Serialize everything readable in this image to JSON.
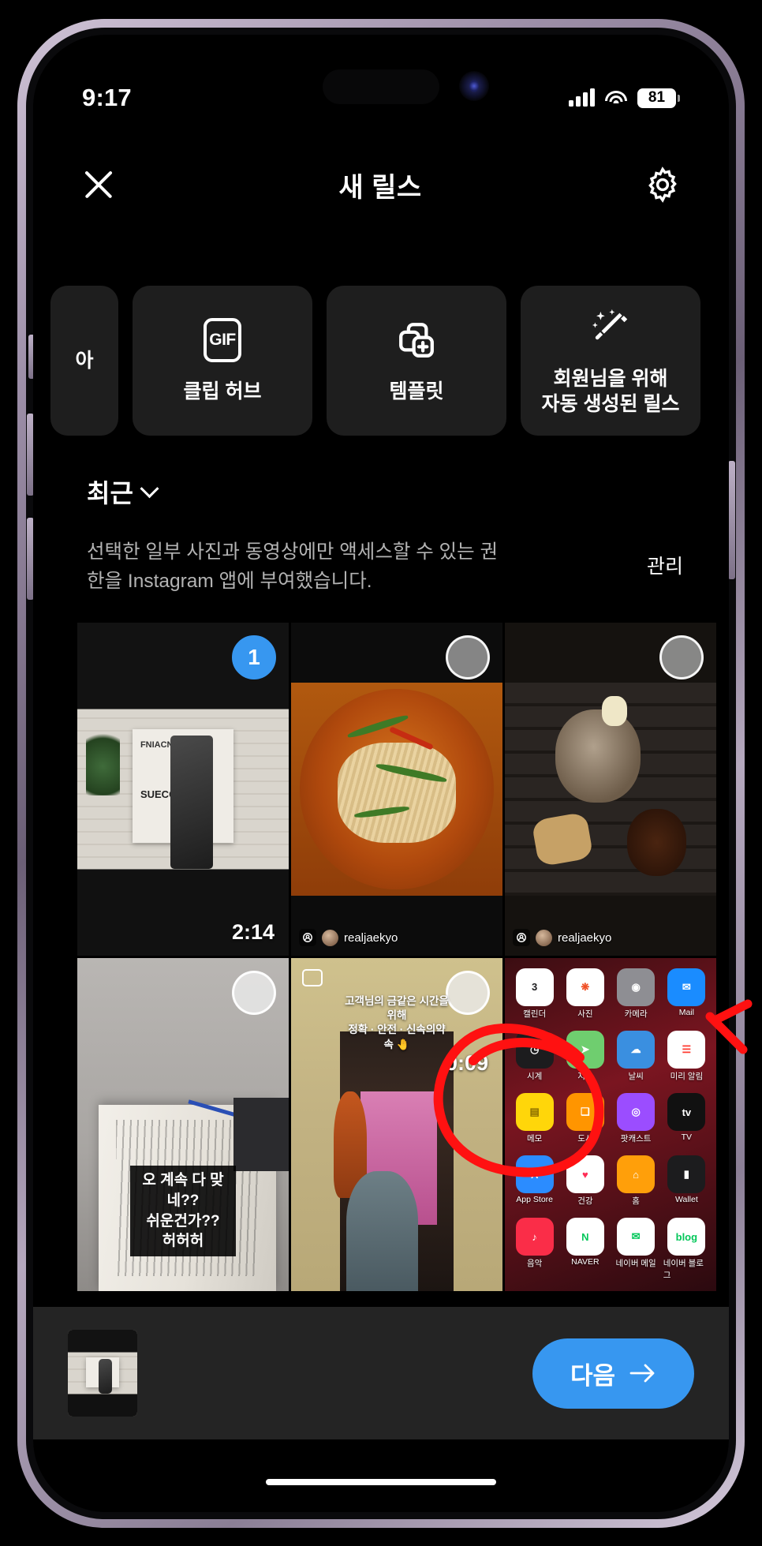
{
  "status_bar": {
    "time": "9:17",
    "battery_percent": "81",
    "signal_icon": "cellular-bars-icon",
    "wifi_icon": "wifi-icon",
    "battery_icon": "battery-icon",
    "front_camera_icon": "front-camera-icon"
  },
  "header": {
    "close_icon": "close-x-icon",
    "title": "새 릴스",
    "settings_icon": "gear-icon"
  },
  "option_cards": [
    {
      "label": "아",
      "icon": "partial-card-icon",
      "partial": true
    },
    {
      "label": "클립 허브",
      "icon": "gif-icon"
    },
    {
      "label": "템플릿",
      "icon": "template-stack-plus-icon"
    },
    {
      "label": "회원님을 위해\n자동 생성된 릴스",
      "icon": "magic-wand-sparkle-icon"
    }
  ],
  "gallery": {
    "sort_label": "최근",
    "sort_chevron_icon": "chevron-down-icon",
    "permission_text": "선택한 일부 사진과 동영상에만 액세스할 수 있는 권한을 Instagram 앱에 부여했습니다.",
    "manage_label": "관리"
  },
  "media_items": [
    {
      "art": "poster",
      "selected": true,
      "selection_number": "1",
      "duration": "2:14",
      "tag": null,
      "poster_title": "FNIACN      TES",
      "poster_sub": "SUECC",
      "video_badge": false,
      "caption": null,
      "top_caption": null
    },
    {
      "art": "noodle",
      "selected": false,
      "selection_number": "",
      "duration": "",
      "tag": "realjaekyo",
      "video_badge": false,
      "caption": null,
      "top_caption": null
    },
    {
      "art": "grill",
      "selected": false,
      "selection_number": "",
      "duration": "",
      "tag": "realjaekyo",
      "video_badge": false,
      "caption": null,
      "top_caption": null
    },
    {
      "art": "book",
      "selected": false,
      "selection_number": "",
      "duration": "",
      "tag": null,
      "video_badge": false,
      "caption": "오 계속 다 맞네??\n쉬운건가??\n허허허",
      "top_caption": null
    },
    {
      "art": "room",
      "selected": false,
      "selection_number": "",
      "duration": "0:09",
      "tag": null,
      "video_badge": true,
      "caption": null,
      "top_caption": "고객님의 금같은 시간을 위해\n정확 · 안전 · 신속의약속 🤚"
    },
    {
      "art": "home",
      "selected": false,
      "selection_number": "",
      "duration": "",
      "tag": null,
      "video_badge": false,
      "caption": null,
      "top_caption": null
    }
  ],
  "home_screen_apps": [
    {
      "name": "캘린더",
      "glyph": "3",
      "color": "#ffffff",
      "text_color": "#1c1c1e"
    },
    {
      "name": "사진",
      "glyph": "❋",
      "color": "#ffffff",
      "text_color": "#f04e23"
    },
    {
      "name": "카메라",
      "glyph": "◉",
      "color": "#8e8e93",
      "text_color": "#ffffff"
    },
    {
      "name": "Mail",
      "glyph": "✉",
      "color": "#1a8cff",
      "text_color": "#ffffff"
    },
    {
      "name": "시계",
      "glyph": "◷",
      "color": "#1c1c1e",
      "text_color": "#ffffff"
    },
    {
      "name": "지도",
      "glyph": "➤",
      "color": "#6fce6f",
      "text_color": "#ffffff"
    },
    {
      "name": "날씨",
      "glyph": "☁",
      "color": "#3a8fe0",
      "text_color": "#ffffff"
    },
    {
      "name": "미리 알림",
      "glyph": "☰",
      "color": "#ffffff",
      "text_color": "#ff3b30"
    },
    {
      "name": "메모",
      "glyph": "▤",
      "color": "#ffd60a",
      "text_color": "#8a6d00"
    },
    {
      "name": "도서",
      "glyph": "❏",
      "color": "#ff9500",
      "text_color": "#ffffff"
    },
    {
      "name": "팟캐스트",
      "glyph": "◎",
      "color": "#9b4dff",
      "text_color": "#ffffff"
    },
    {
      "name": "TV",
      "glyph": "tv",
      "color": "#111111",
      "text_color": "#ffffff"
    },
    {
      "name": "App Store",
      "glyph": "A",
      "color": "#2b8cff",
      "text_color": "#ffffff"
    },
    {
      "name": "건강",
      "glyph": "♥",
      "color": "#ffffff",
      "text_color": "#ff2d55"
    },
    {
      "name": "홈",
      "glyph": "⌂",
      "color": "#ff9f0a",
      "text_color": "#ffffff"
    },
    {
      "name": "Wallet",
      "glyph": "▮",
      "color": "#1c1c1e",
      "text_color": "#ffffff"
    },
    {
      "name": "음악",
      "glyph": "♪",
      "color": "#fa2d48",
      "text_color": "#ffffff"
    },
    {
      "name": "NAVER",
      "glyph": "N",
      "color": "#ffffff",
      "text_color": "#03c75a"
    },
    {
      "name": "네이버 메일",
      "glyph": "✉",
      "color": "#ffffff",
      "text_color": "#03c75a"
    },
    {
      "name": "네이버 블로그",
      "glyph": "blog",
      "color": "#ffffff",
      "text_color": "#03c75a"
    }
  ],
  "bottom_bar": {
    "selected_thumb_name": "selected-media-thumbnail",
    "next_label": "다음",
    "next_arrow_icon": "arrow-right-icon"
  },
  "annotation": {
    "shape": "red-hand-drawn-circle",
    "color": "#ff1111",
    "target": "next-button"
  },
  "colors": {
    "accent_blue": "#3797f0",
    "card_bg": "#1e1e1e",
    "bottom_bar_bg": "#242424",
    "muted_text": "#b3b3b3",
    "annotation_red": "#ff1111"
  }
}
